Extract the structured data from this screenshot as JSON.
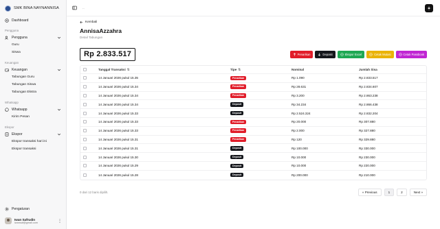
{
  "brand": {
    "name": "SMK BINA NAYNANNISA"
  },
  "sidebar": {
    "dashboard": "Dashboard",
    "sections": [
      {
        "label": "Pengguna",
        "parent": "Pengguna",
        "items": [
          "Guru",
          "Siswa"
        ]
      },
      {
        "label": "Keuangan",
        "parent": "Keuangan",
        "items": [
          "Tabungan Guru",
          "Tabungan Siswa",
          "Tabungan Ekstra"
        ]
      },
      {
        "label": "Whatsapp",
        "parent": "Whatsapp",
        "items": [
          "Kirim Pesan"
        ]
      },
      {
        "label": "Ekspor",
        "parent": "Ekspor",
        "items": [
          "Ekspor transaksi hari ini",
          "Ekspor transaksi"
        ]
      }
    ],
    "settings": "Pengaturan",
    "user": {
      "name": "Iwan Safrudin",
      "email": "iwansaf@gmail.com"
    }
  },
  "topbar": {
    "breadcrumb": ".."
  },
  "page": {
    "back_label": "Kembali",
    "title": "AnnisaAzzahra",
    "subtitle": "Detail Tabungan",
    "balance": "Rp 2.833.517"
  },
  "actions": {
    "penarikan": "Penarikan",
    "deposit": "Deposit",
    "ekspor_excel": "Ekspor Excel",
    "cetak_mutasi": "Cetak Mutasi",
    "cetak_passbook": "Cetak Passbook"
  },
  "table": {
    "headers": {
      "date": "Tanggal Transaksi",
      "type": "Tipe",
      "nominal": "Nominal",
      "sisa": "Jumlah Sisa"
    },
    "rows": [
      {
        "date": "14 Januari 2026 pukul 15.35",
        "type": "Penarikan",
        "nominal": "Rp 1.090",
        "sisa": "Rp 2.833.517"
      },
      {
        "date": "14 Januari 2026 pukul 15.34",
        "type": "Penarikan",
        "nominal": "Rp 28.631",
        "sisa": "Rp 2.834.607"
      },
      {
        "date": "14 Januari 2026 pukul 15.34",
        "type": "Penarikan",
        "nominal": "Rp 3.200",
        "sisa": "Rp 2.863.238"
      },
      {
        "date": "14 Januari 2026 pukul 15.34",
        "type": "Deposit",
        "nominal": "Rp 34.234",
        "sisa": "Rp 2.866.438"
      },
      {
        "date": "14 Januari 2026 pukul 15.33",
        "type": "Deposit",
        "nominal": "Rp 2.524.324",
        "sisa": "Rp 2.832.204"
      },
      {
        "date": "14 Januari 2026 pukul 15.33",
        "type": "Penarikan",
        "nominal": "Rp 20.000",
        "sisa": "Rp 307.880"
      },
      {
        "date": "14 Januari 2026 pukul 15.33",
        "type": "Penarikan",
        "nominal": "Rp 2.000",
        "sisa": "Rp 327.880"
      },
      {
        "date": "14 Januari 2026 pukul 15.31",
        "type": "Penarikan",
        "nominal": "Rp 120",
        "sisa": "Rp 329.880"
      },
      {
        "date": "14 Januari 2026 pukul 15.31",
        "type": "Deposit",
        "nominal": "Rp 100.000",
        "sisa": "Rp 330.000"
      },
      {
        "date": "14 Januari 2026 pukul 15.30",
        "type": "Deposit",
        "nominal": "Rp 10.000",
        "sisa": "Rp 230.000"
      },
      {
        "date": "14 Januari 2026 pukul 15.29",
        "type": "Deposit",
        "nominal": "Rp 10.000",
        "sisa": "Rp 220.000"
      },
      {
        "date": "14 Januari 2026 pukul 15.28",
        "type": "Deposit",
        "nominal": "Rp 200.000",
        "sisa": "Rp 210.000"
      }
    ]
  },
  "footer": {
    "selection_text": "0 dari 12 baris dipilih."
  },
  "pagination": {
    "previous": "« Previous",
    "pages": [
      "1",
      "2"
    ],
    "next": "Next »"
  },
  "colors": {
    "penarikan": "#e11d2a",
    "deposit": "#15171c",
    "excel": "#1ea853",
    "mutasi": "#eab308",
    "passbook": "#c026d3"
  }
}
